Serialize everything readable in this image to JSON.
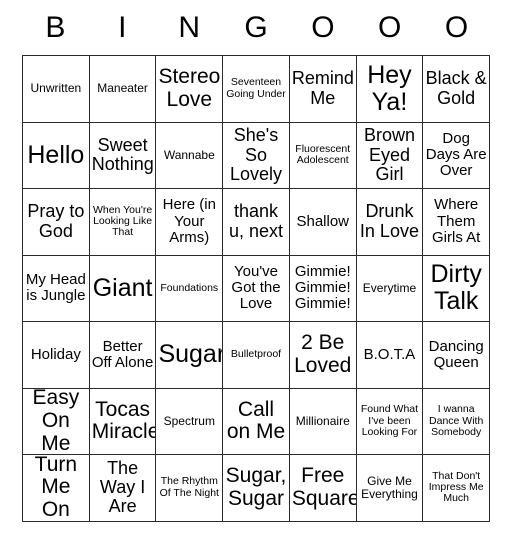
{
  "card": {
    "title": "BINGOOO",
    "header_letters": [
      "B",
      "I",
      "N",
      "G",
      "O",
      "O",
      "O"
    ],
    "columns": 7,
    "rows": 7,
    "border_color": "#2b2b2b",
    "background_color": "#ffffff",
    "text_color": "#000000",
    "free_space_label": "Free Square",
    "cells": [
      [
        {
          "text": "Unwritten",
          "size": "s"
        },
        {
          "text": "Maneater",
          "size": "s"
        },
        {
          "text": "Stereo Love",
          "size": "xl"
        },
        {
          "text": "Seventeen Going Under",
          "size": "xs"
        },
        {
          "text": "Remind Me",
          "size": "l"
        },
        {
          "text": "Hey Ya!",
          "size": "xxl"
        },
        {
          "text": "Black & Gold",
          "size": "l"
        }
      ],
      [
        {
          "text": "Hello",
          "size": "xxl"
        },
        {
          "text": "Sweet Nothing",
          "size": "l"
        },
        {
          "text": "Wannabe",
          "size": "s"
        },
        {
          "text": "She's So Lovely",
          "size": "l"
        },
        {
          "text": "Fluorescent Adolescent",
          "size": "xs"
        },
        {
          "text": "Brown Eyed Girl",
          "size": "l"
        },
        {
          "text": "Dog Days Are Over",
          "size": "m"
        }
      ],
      [
        {
          "text": "Pray to God",
          "size": "l"
        },
        {
          "text": "When You're Looking Like That",
          "size": "xs"
        },
        {
          "text": "Here (in Your Arms)",
          "size": "m"
        },
        {
          "text": "thank u, next",
          "size": "l"
        },
        {
          "text": "Shallow",
          "size": "m"
        },
        {
          "text": "Drunk In Love",
          "size": "l"
        },
        {
          "text": "Where Them Girls At",
          "size": "m"
        }
      ],
      [
        {
          "text": "My Head is Jungle",
          "size": "m"
        },
        {
          "text": "Giant",
          "size": "xxl"
        },
        {
          "text": "Foundations",
          "size": "xs"
        },
        {
          "text": "You've Got the Love",
          "size": "m"
        },
        {
          "text": "Gimmie! Gimmie! Gimmie!",
          "size": "m"
        },
        {
          "text": "Everytime",
          "size": "s"
        },
        {
          "text": "Dirty Talk",
          "size": "xxl"
        }
      ],
      [
        {
          "text": "Holiday",
          "size": "m"
        },
        {
          "text": "Better Off Alone",
          "size": "m"
        },
        {
          "text": "Sugar",
          "size": "xxl"
        },
        {
          "text": "Bulletproof",
          "size": "xs"
        },
        {
          "text": "2 Be Loved",
          "size": "xl"
        },
        {
          "text": "B.O.T.A",
          "size": "m"
        },
        {
          "text": "Dancing Queen",
          "size": "m"
        }
      ],
      [
        {
          "text": "Easy On Me",
          "size": "xl"
        },
        {
          "text": "Tocas Miracle",
          "size": "xl"
        },
        {
          "text": "Spectrum",
          "size": "s"
        },
        {
          "text": "Call on Me",
          "size": "xl"
        },
        {
          "text": "Millionaire",
          "size": "s"
        },
        {
          "text": "Found What I've been Looking For",
          "size": "xs"
        },
        {
          "text": "I wanna Dance With Somebody",
          "size": "xs"
        }
      ],
      [
        {
          "text": "Turn Me On",
          "size": "xl"
        },
        {
          "text": "The Way I Are",
          "size": "l"
        },
        {
          "text": "The Rhythm Of The Night",
          "size": "xs"
        },
        {
          "text": "Sugar, Sugar",
          "size": "xl"
        },
        {
          "text": "Free Square",
          "size": "xl"
        },
        {
          "text": "Give Me Everything",
          "size": "s"
        },
        {
          "text": "That Don't Impress Me Much",
          "size": "xs"
        }
      ]
    ]
  }
}
